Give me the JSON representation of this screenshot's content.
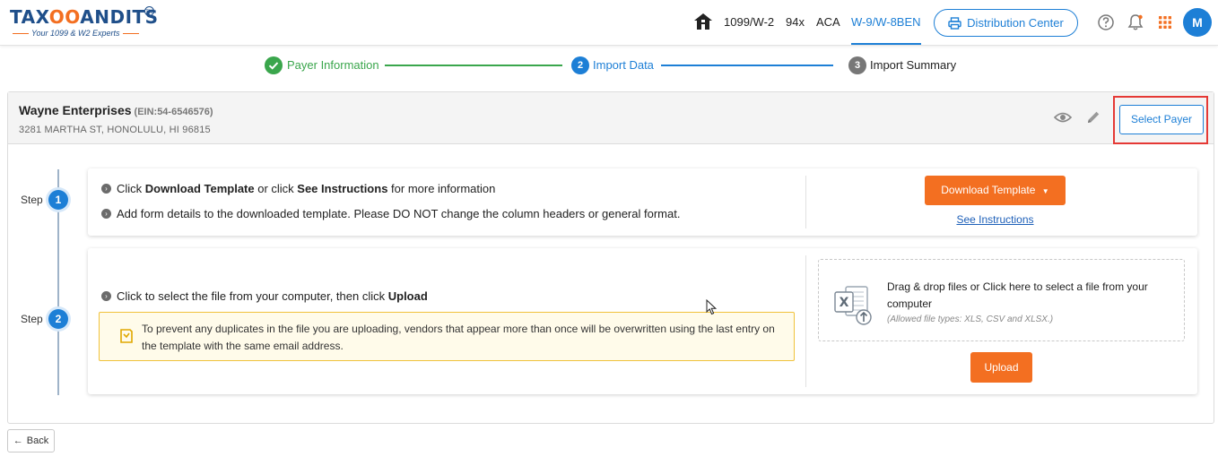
{
  "brand": {
    "logo_text": "TAX",
    "logo_owl": "OO",
    "logo_text_end": "ANDITS",
    "logo_tm": "TM",
    "tagline": "Your 1099 & W2 Experts"
  },
  "nav": {
    "items": [
      "1099/W-2",
      "94x",
      "ACA",
      "W-9/W-8BEN"
    ],
    "active": "W-9/W-8BEN",
    "distribution_center": "Distribution Center",
    "avatar_initial": "M"
  },
  "stepper": {
    "steps": [
      {
        "number": "",
        "label": "Payer Information",
        "state": "complete"
      },
      {
        "number": "2",
        "label": "Import Data",
        "state": "active"
      },
      {
        "number": "3",
        "label": "Import Summary",
        "state": "pending"
      }
    ]
  },
  "payer": {
    "name": "Wayne Enterprises",
    "ein": "(EIN:54-6546576)",
    "address": "3281 MARTHA ST, HONOLULU, HI 96815",
    "select_button": "Select Payer"
  },
  "step1": {
    "tag": "Step",
    "number": "1",
    "line1_prefix": "Click ",
    "line1_bold1": "Download Template",
    "line1_mid": " or click ",
    "line1_bold2": "See Instructions",
    "line1_suffix": " for more information",
    "line2": "Add form details to the downloaded template. Please DO NOT change the column headers or general format.",
    "download_button": "Download Template",
    "instructions_link": "See Instructions"
  },
  "step2": {
    "tag": "Step",
    "number": "2",
    "line_prefix": "Click to select the file from your computer, then click ",
    "line_bold": "Upload",
    "note": "To prevent any duplicates in the file you are uploading, vendors that appear more than once will be overwritten using the last entry on the template with the same email address.",
    "drop_text": "Drag & drop files or Click here to select a file from your computer",
    "drop_types": "(Allowed file types: XLS, CSV and XLSX.)",
    "upload_button": "Upload"
  },
  "footer": {
    "back_button": "Back"
  },
  "colors": {
    "primary": "#1d7fd6",
    "accent": "#f36f21",
    "success": "#3aa64c",
    "highlight": "#e53935"
  }
}
